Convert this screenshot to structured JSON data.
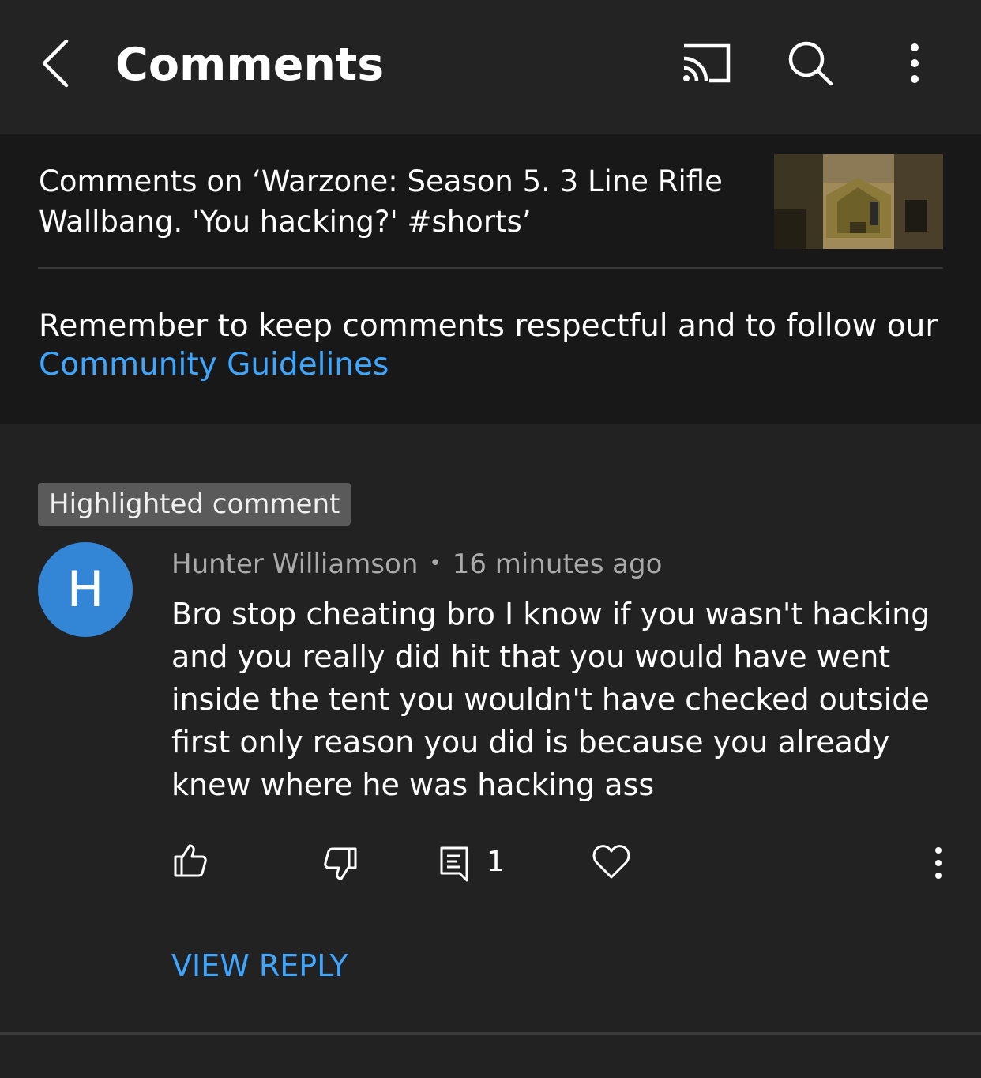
{
  "app_bar": {
    "title": "Comments",
    "back_icon": "chevron-left-icon",
    "cast_icon": "cast-icon",
    "search_icon": "search-icon",
    "more_icon": "more-vertical-icon"
  },
  "header": {
    "video_title": "Comments on ‘Warzone: Season 5. 3 Line Rifle Wallbang. 'You hacking?' #shorts’",
    "reminder_text": "Remember to keep comments respectful and to follow our ",
    "guidelines_link": "Community Guidelines"
  },
  "comment": {
    "badge": "Highlighted comment",
    "avatar_initial": "H",
    "avatar_color": "#3385d6",
    "author": "Hunter Williamson",
    "separator": "•",
    "time": "16 minutes ago",
    "text": "Bro stop cheating bro I know if you wasn't hacking and you really did hit that you would have went inside the tent you wouldn't have checked outside first only reason you did is because you already knew where he was hacking ass",
    "actions": {
      "like_icon": "thumbs-up-icon",
      "dislike_icon": "thumbs-down-icon",
      "reply_icon": "reply-comment-icon",
      "reply_count": "1",
      "heart_icon": "heart-icon",
      "more_icon": "more-vertical-icon"
    },
    "view_reply": "VIEW REPLY"
  },
  "colors": {
    "background": "#222222",
    "header_background": "#181818",
    "link": "#3ea6ff",
    "secondary_text": "#aaaaaa"
  }
}
